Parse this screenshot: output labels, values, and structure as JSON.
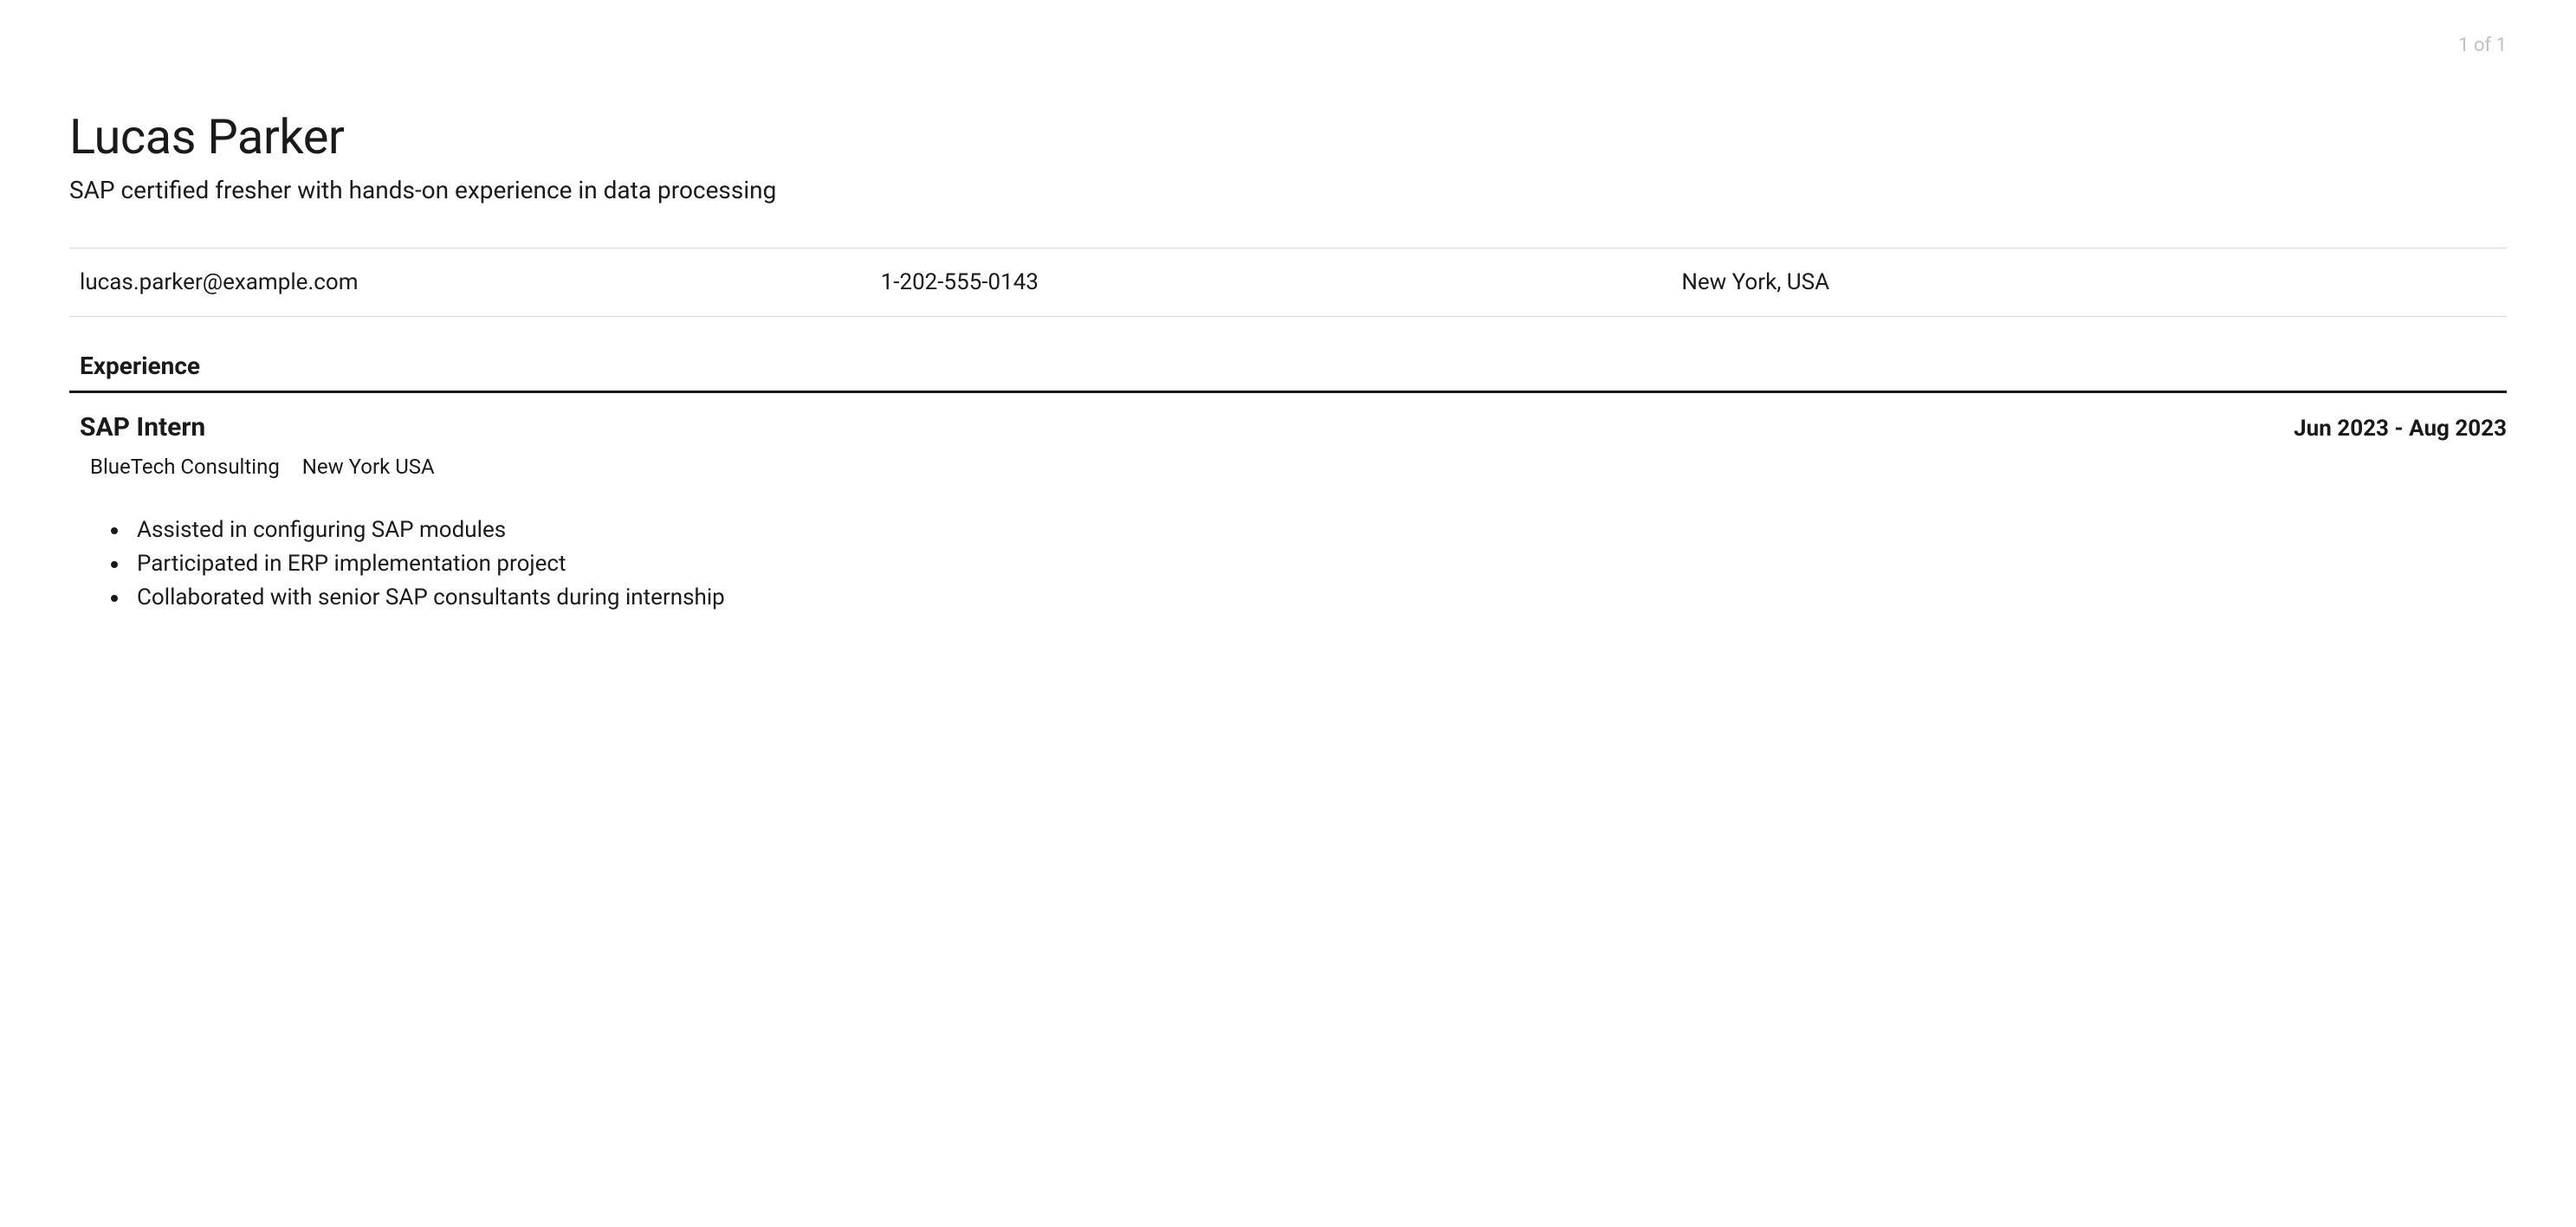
{
  "page_number": "1 of 1",
  "header": {
    "name": "Lucas Parker",
    "subtitle": "SAP certified fresher with hands-on experience in data processing"
  },
  "contact": {
    "email": "lucas.parker@example.com",
    "phone": "1-202-555-0143",
    "location": "New York, USA"
  },
  "sections": {
    "experience": {
      "heading": "Experience",
      "jobs": [
        {
          "title": "SAP Intern",
          "dates": "Jun 2023 - Aug 2023",
          "company": "BlueTech Consulting",
          "location": "New York USA",
          "bullets": [
            "Assisted in configuring SAP modules",
            "Participated in ERP implementation project",
            "Collaborated with senior SAP consultants during internship"
          ]
        }
      ]
    }
  }
}
